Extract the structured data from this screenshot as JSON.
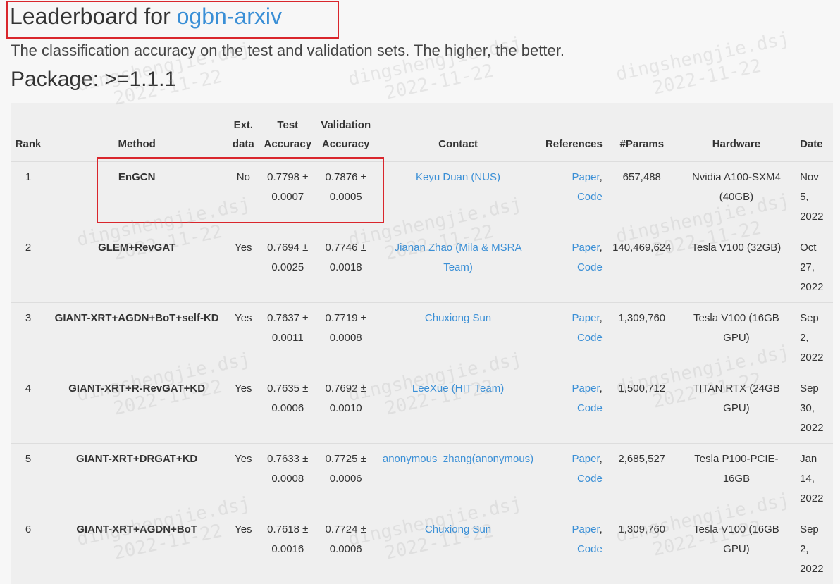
{
  "header": {
    "title_prefix": "Leaderboard for ",
    "title_link": "ogbn-arxiv",
    "subtitle": "The classification accuracy on the test and validation sets. The higher, the better.",
    "package": "Package: >=1.1.1"
  },
  "table": {
    "columns": {
      "rank": "Rank",
      "method": "Method",
      "ext_line1": "Ext.",
      "ext_line2": "data",
      "test_line1": "Test",
      "test_line2": "Accuracy",
      "val_line1": "Validation",
      "val_line2": "Accuracy",
      "contact": "Contact",
      "references": "References",
      "params": "#Params",
      "hardware": "Hardware",
      "date": "Date"
    },
    "rows": [
      {
        "rank": "1",
        "method": "EnGCN",
        "ext": "No",
        "test_val": "0.7798 ±",
        "test_std": "0.0007",
        "val_val": "0.7876 ±",
        "val_std": "0.0005",
        "contact": "Keyu Duan (NUS)",
        "paper": "Paper",
        "code": "Code",
        "params": "657,488",
        "hardware": "Nvidia A100-SXM4 (40GB)",
        "date_m": "Nov",
        "date_d": "5,",
        "date_y": "2022"
      },
      {
        "rank": "2",
        "method": "GLEM+RevGAT",
        "ext": "Yes",
        "test_val": "0.7694 ±",
        "test_std": "0.0025",
        "val_val": "0.7746 ±",
        "val_std": "0.0018",
        "contact": "Jianan Zhao (Mila & MSRA Team)",
        "paper": "Paper",
        "code": "Code",
        "params": "140,469,624",
        "hardware": "Tesla V100 (32GB)",
        "date_m": "Oct",
        "date_d": "27,",
        "date_y": "2022"
      },
      {
        "rank": "3",
        "method": "GIANT-XRT+AGDN+BoT+self-KD",
        "ext": "Yes",
        "test_val": "0.7637 ±",
        "test_std": "0.0011",
        "val_val": "0.7719 ±",
        "val_std": "0.0008",
        "contact": "Chuxiong Sun",
        "paper": "Paper",
        "code": "Code",
        "params": "1,309,760",
        "hardware": "Tesla V100 (16GB GPU)",
        "date_m": "Sep",
        "date_d": "2,",
        "date_y": "2022"
      },
      {
        "rank": "4",
        "method": "GIANT-XRT+R-RevGAT+KD",
        "ext": "Yes",
        "test_val": "0.7635 ±",
        "test_std": "0.0006",
        "val_val": "0.7692 ±",
        "val_std": "0.0010",
        "contact": "LeeXue (HIT Team)",
        "paper": "Paper",
        "code": "Code",
        "params": "1,500,712",
        "hardware": "TITAN RTX (24GB GPU)",
        "date_m": "Sep",
        "date_d": "30,",
        "date_y": "2022"
      },
      {
        "rank": "5",
        "method": "GIANT-XRT+DRGAT+KD",
        "ext": "Yes",
        "test_val": "0.7633 ±",
        "test_std": "0.0008",
        "val_val": "0.7725 ±",
        "val_std": "0.0006",
        "contact": "anonymous_zhang(anonymous)",
        "paper": "Paper",
        "code": "Code",
        "params": "2,685,527",
        "hardware": "Tesla P100-PCIE-16GB",
        "date_m": "Jan",
        "date_d": "14,",
        "date_y": "2022"
      },
      {
        "rank": "6",
        "method": "GIANT-XRT+AGDN+BoT",
        "ext": "Yes",
        "test_val": "0.7618 ±",
        "test_std": "0.0016",
        "val_val": "0.7724 ±",
        "val_std": "0.0006",
        "contact": "Chuxiong Sun",
        "paper": "Paper",
        "code": "Code",
        "params": "1,309,760",
        "hardware": "Tesla V100 (16GB GPU)",
        "date_m": "Sep",
        "date_d": "2,",
        "date_y": "2022"
      }
    ]
  },
  "watermark": {
    "line1": "dingshengjie.dsj",
    "line2": "2022-11-22"
  },
  "colors": {
    "link": "#3a8fd6",
    "highlight_border": "#d9262c",
    "table_bg": "#efefef"
  }
}
